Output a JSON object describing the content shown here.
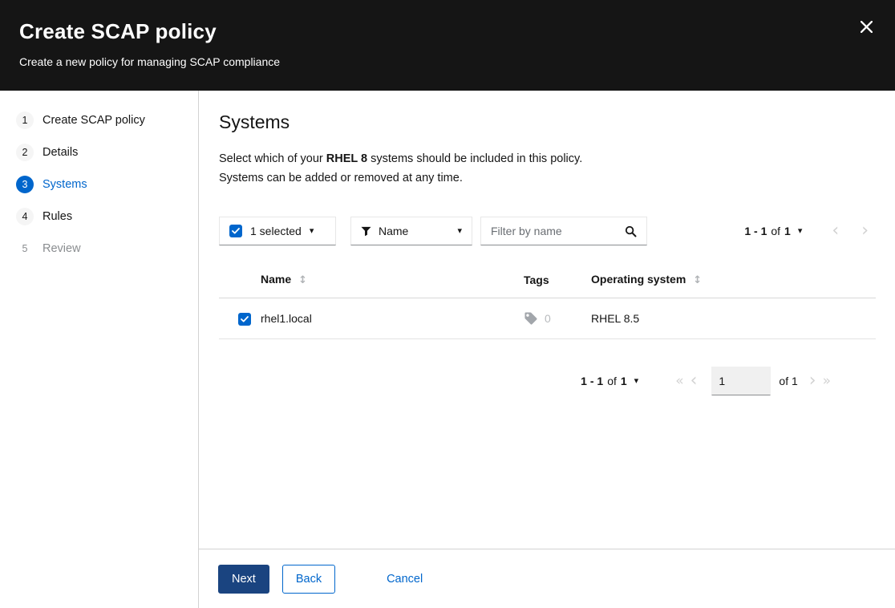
{
  "modal": {
    "title": "Create SCAP policy",
    "subtitle": "Create a new policy for managing SCAP compliance"
  },
  "wizard": {
    "steps": [
      {
        "num": "1",
        "label": "Create SCAP policy",
        "state": "visited"
      },
      {
        "num": "2",
        "label": "Details",
        "state": "visited"
      },
      {
        "num": "3",
        "label": "Systems",
        "state": "current"
      },
      {
        "num": "4",
        "label": "Rules",
        "state": "visited"
      },
      {
        "num": "5",
        "label": "Review",
        "state": "disabled"
      }
    ]
  },
  "content": {
    "heading": "Systems",
    "description": {
      "line1_prefix": "Select which of your ",
      "line1_bold": "RHEL 8",
      "line1_suffix": " systems should be included in this policy.",
      "line2": "Systems can be added or removed at any time."
    }
  },
  "toolbar": {
    "bulk_select_label": "1 selected",
    "bulk_select_checked": true,
    "filter_attribute": "Name",
    "search_placeholder": "Filter by name",
    "pagination": {
      "range": "1 - 1",
      "of_word": "of",
      "total": "1"
    }
  },
  "table": {
    "columns": {
      "name": "Name",
      "tags": "Tags",
      "os": "Operating system"
    },
    "rows": [
      {
        "selected": true,
        "name": "rhel1.local",
        "tag_count": "0",
        "os": "RHEL 8.5"
      }
    ]
  },
  "pagination_bottom": {
    "range": "1 - 1",
    "of_word": "of",
    "total": "1",
    "page_value": "1",
    "of_pages": "of 1"
  },
  "footer": {
    "next_label": "Next",
    "back_label": "Back",
    "cancel_label": "Cancel"
  },
  "colors": {
    "primary": "#0066cc",
    "header_background": "#151515",
    "next_button_background": "#1a4480",
    "disabled_text": "#8a8d90"
  }
}
